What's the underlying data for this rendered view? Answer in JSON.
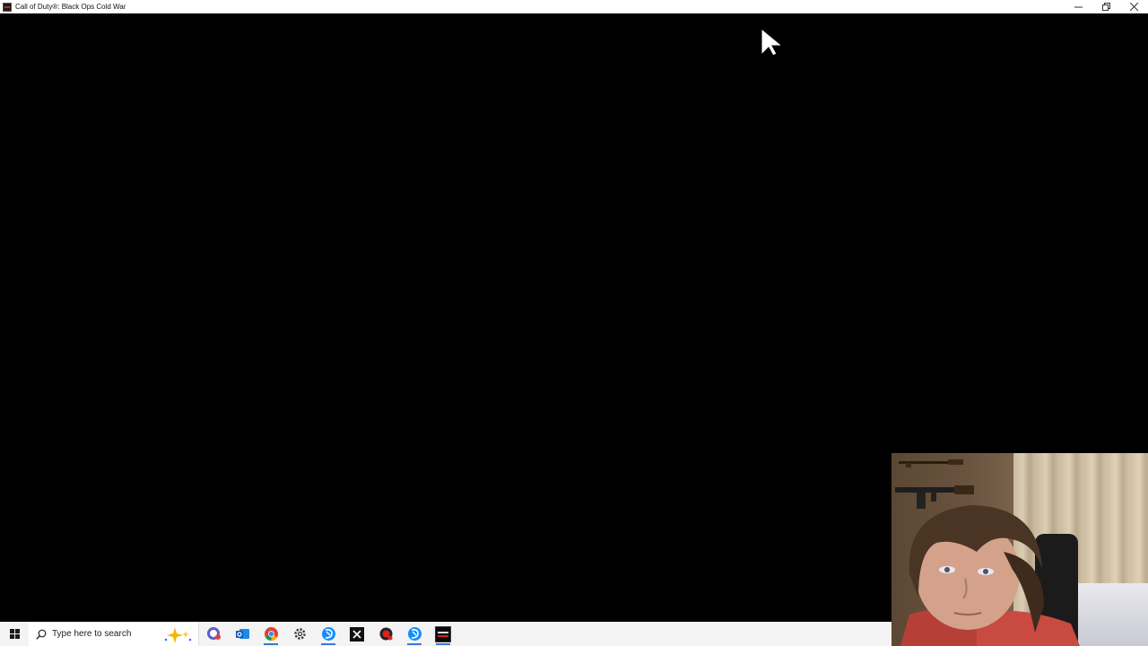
{
  "window": {
    "title": "Call of Duty®: Black Ops Cold War"
  },
  "taskbar": {
    "search_placeholder": "Type here to search",
    "apps": [
      {
        "name": "chat-icon",
        "active": false
      },
      {
        "name": "outlook-icon",
        "active": false
      },
      {
        "name": "chrome-icon",
        "active": true
      },
      {
        "name": "settings-icon",
        "active": false
      },
      {
        "name": "battlenet-icon",
        "active": true
      },
      {
        "name": "epic-games-icon",
        "active": false
      },
      {
        "name": "record-icon",
        "active": false
      },
      {
        "name": "battlenet-icon",
        "active": true
      },
      {
        "name": "black-ops-icon",
        "active": true
      }
    ]
  },
  "colors": {
    "taskbar_bg": "#f3f3f3",
    "accent": "#3b78d8",
    "game_bg": "#000000"
  }
}
